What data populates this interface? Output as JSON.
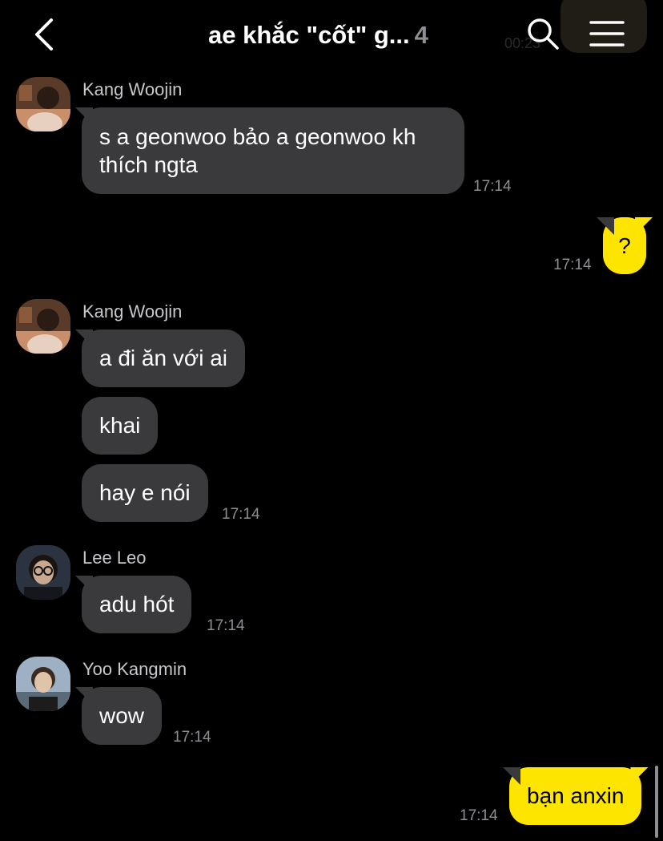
{
  "header": {
    "title": "ae khắc \"cốt\" g...",
    "member_count": "4",
    "ghost_time": "00:23",
    "icons": {
      "back": "chevron-left-icon",
      "search": "search-icon",
      "menu": "hamburger-menu-icon"
    }
  },
  "colors": {
    "background": "#000000",
    "other_bubble": "#3a3a3c",
    "my_bubble": "#fee500",
    "time": "#8e8e93"
  },
  "messages": [
    {
      "sender": "Kang Woojin",
      "text_line1": "s a geonwoo bảo a geonwoo kh",
      "text_line2": "thích ngta",
      "time": "17:14"
    },
    {
      "sender": "me",
      "text": "?",
      "time": "17:14"
    },
    {
      "sender": "Kang Woojin",
      "texts": [
        "a đi ăn với ai",
        "khai",
        "hay e nói"
      ],
      "time": "17:14"
    },
    {
      "sender": "Lee Leo",
      "text": "adu hót",
      "time": "17:14"
    },
    {
      "sender": "Yoo Kangmin",
      "text": "wow",
      "time": "17:14"
    },
    {
      "sender": "me",
      "text": "bạn anxin",
      "time": "17:14"
    }
  ]
}
